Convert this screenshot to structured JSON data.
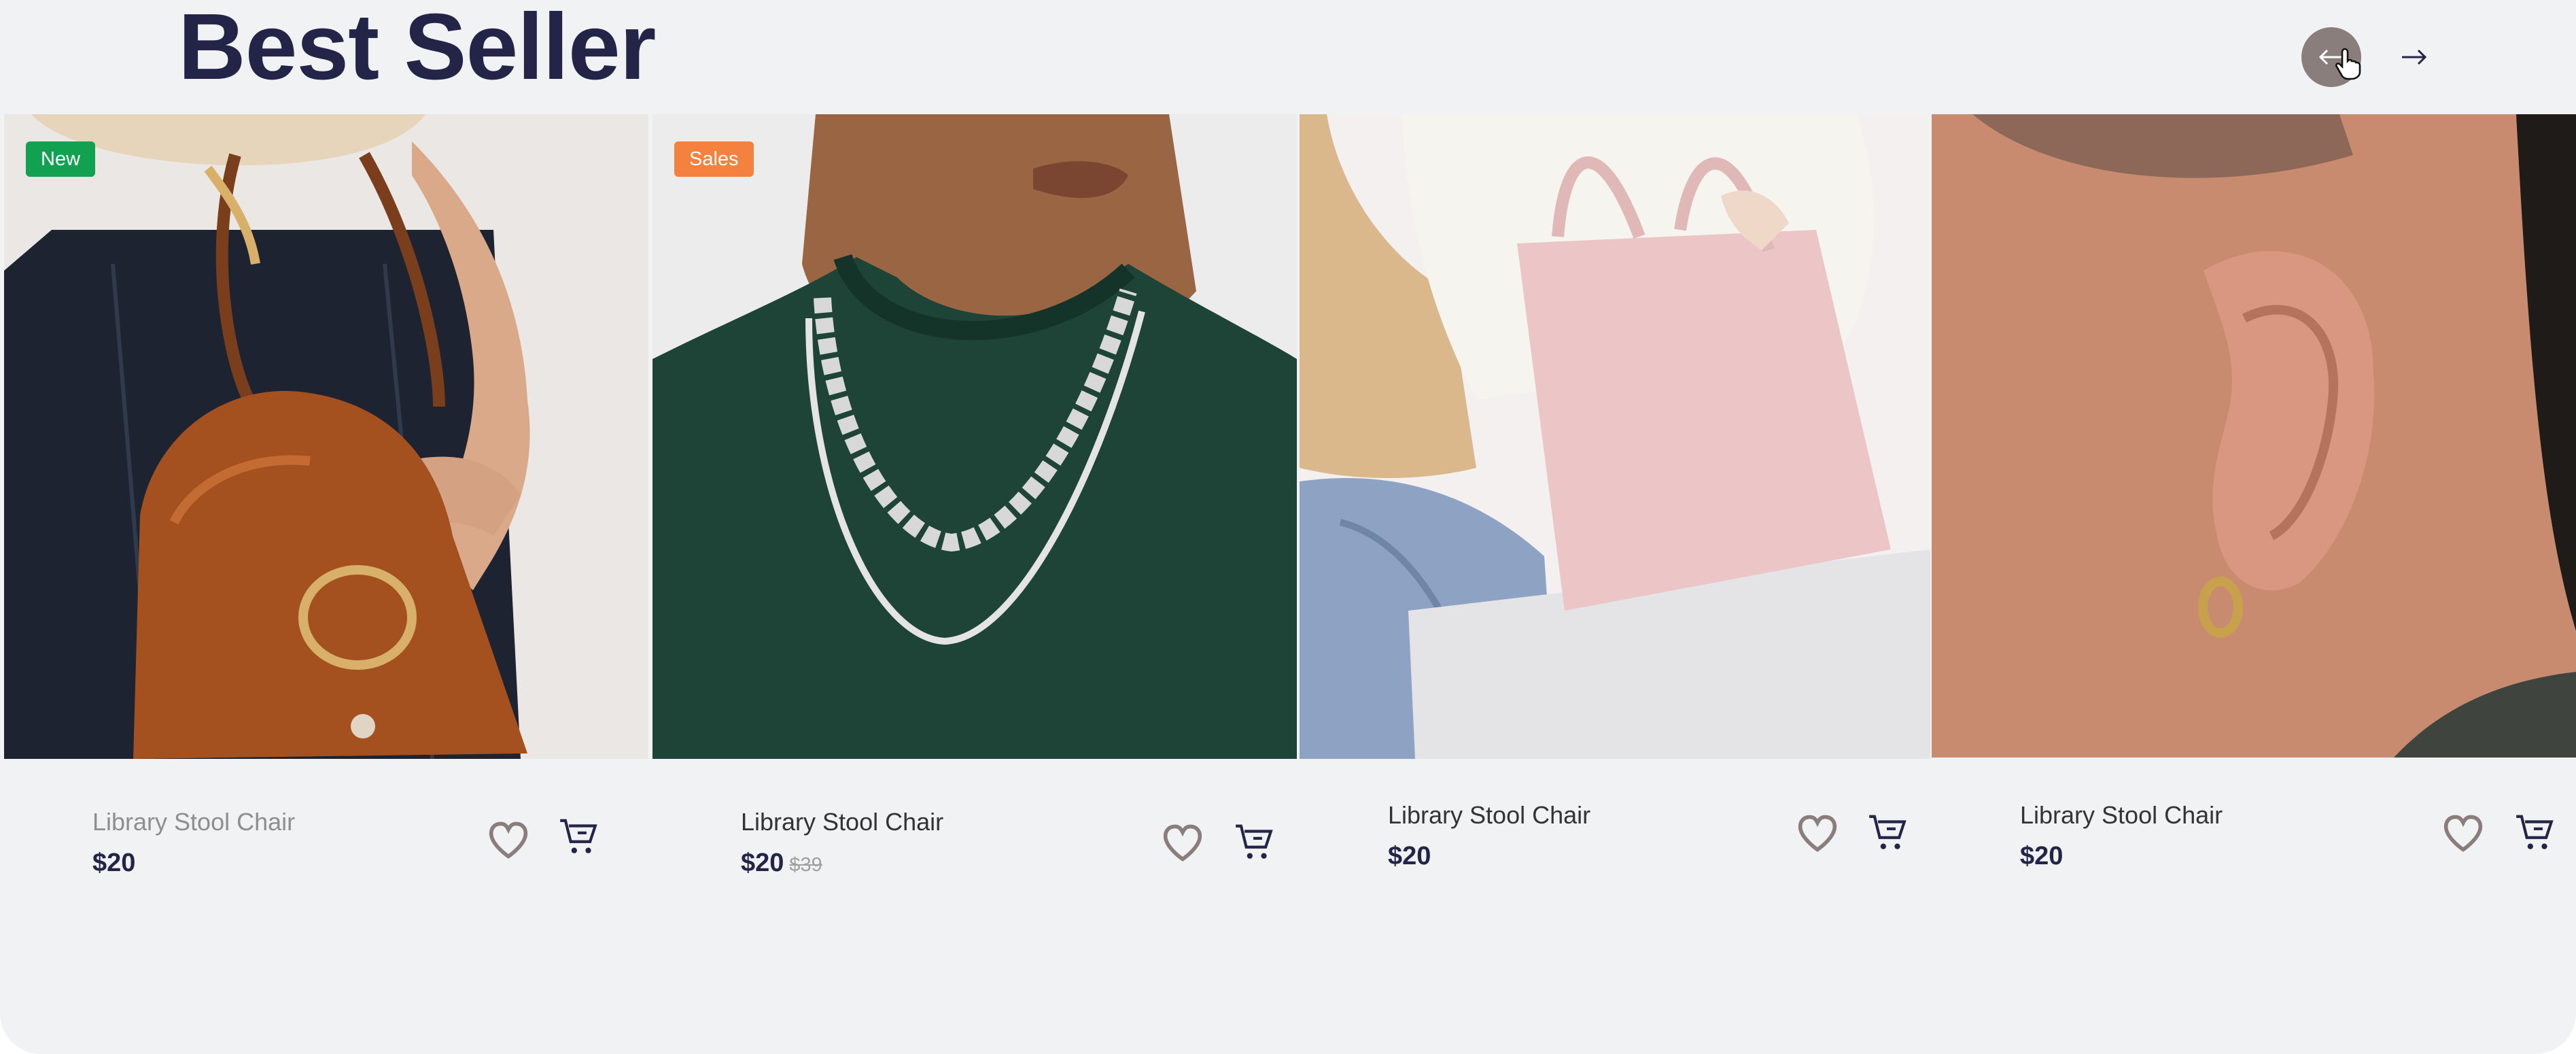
{
  "section": {
    "title": "Best Seller"
  },
  "nav": {
    "prev_icon": "arrow-left-icon",
    "next_icon": "arrow-right-icon"
  },
  "products": [
    {
      "badge": "New",
      "badge_color": "#12a150",
      "name": "Library Stool Chair",
      "price": "$20",
      "old_price": ""
    },
    {
      "badge": "Sales",
      "badge_color": "#f5813f",
      "name": "Library Stool Chair",
      "price": "$20",
      "old_price": "$39"
    },
    {
      "badge": "",
      "badge_color": "",
      "name": "Library Stool Chair",
      "price": "$20",
      "old_price": ""
    },
    {
      "badge": "",
      "badge_color": "",
      "name": "Library Stool Chair",
      "price": "$20",
      "old_price": ""
    }
  ],
  "colors": {
    "title": "#232447",
    "background": "#f1f2f4",
    "nav_active": "#8a7e7d",
    "heart": "#8a7e7d"
  }
}
